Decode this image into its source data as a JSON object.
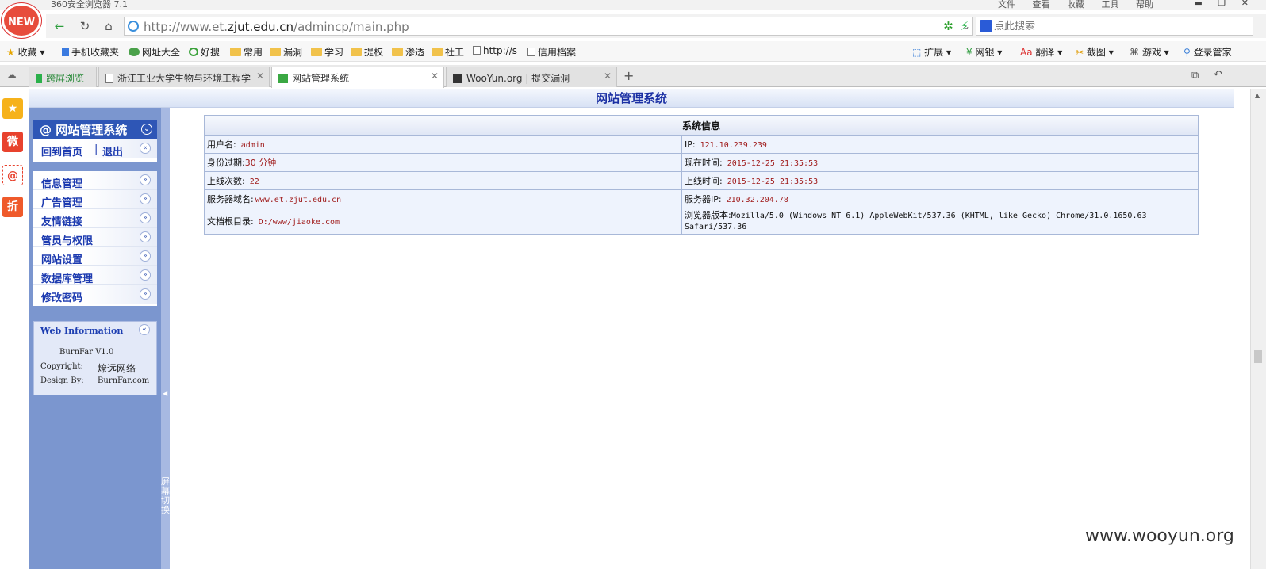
{
  "browser": {
    "app_title": "360安全浏览器 7.1",
    "badge": "NEW",
    "menu": [
      "文件",
      "查看",
      "收藏",
      "工具",
      "帮助"
    ],
    "url_prefix": "http://www.et.",
    "url_host": "zjut.edu.cn",
    "url_path": "/admincp/main.php",
    "search_placeholder": "点此搜索"
  },
  "bookmarks": {
    "fav": "收藏",
    "items": [
      "手机收藏夹",
      "网址大全",
      "好搜",
      "常用",
      "漏洞",
      "学习",
      "提权",
      "渗透",
      "社工",
      "http://s",
      "信用档案"
    ],
    "right_tools": [
      "扩展",
      "网银",
      "翻译",
      "截图",
      "游戏",
      "登录管家"
    ]
  },
  "tabs": {
    "split": "跨屏浏览",
    "items": [
      {
        "label": "浙江工业大学生物与环境工程学"
      },
      {
        "label": "网站管理系统"
      },
      {
        "label": "WooYun.org | 提交漏洞"
      }
    ]
  },
  "quick_sidebar": {
    "items": [
      "★",
      "微",
      "@",
      "折"
    ]
  },
  "admin": {
    "header_title": "网站管理系统",
    "sidebar": {
      "title": "@ 网站管理系统",
      "home": "回到首页",
      "separator": "|",
      "logout": "退出",
      "menu": [
        "信息管理",
        "广告管理",
        "友情链接",
        "管员与权限",
        "网站设置",
        "数据库管理",
        "修改密码"
      ],
      "splitter_text": "屏幕切换"
    },
    "web_info": {
      "title": "Web Information",
      "product": "BurnFar V1.0",
      "copyright_label": "Copyright:",
      "copyright_value": "燎远网络",
      "design_label": "Design By:",
      "design_value": "BurnFar.com"
    },
    "sysinfo": {
      "title": "系统信息",
      "rows": [
        {
          "l_label": "用户名:",
          "l_value": "admin",
          "r_label": "IP:",
          "r_value": "121.10.239.239"
        },
        {
          "l_label": "身份过期:",
          "l_value": "30 分钟",
          "r_label": "现在时间:",
          "r_value": "2015-12-25 21:35:53"
        },
        {
          "l_label": "上线次数:",
          "l_value": "22",
          "r_label": "上线时间:",
          "r_value": "2015-12-25 21:35:53"
        },
        {
          "l_label": "服务器域名:",
          "l_value": "www.et.zjut.edu.cn",
          "r_label": "服务器IP:",
          "r_value": "210.32.204.78"
        },
        {
          "l_label": "文档根目录:",
          "l_value": "D:/www/jiaoke.com",
          "r_label": "浏览器版本:",
          "r_value": "Mozilla/5.0 (Windows NT 6.1) AppleWebKit/537.36 (KHTML, like Gecko) Chrome/31.0.1650.63 Safari/537.36"
        }
      ]
    }
  },
  "watermark": "www.wooyun.org"
}
